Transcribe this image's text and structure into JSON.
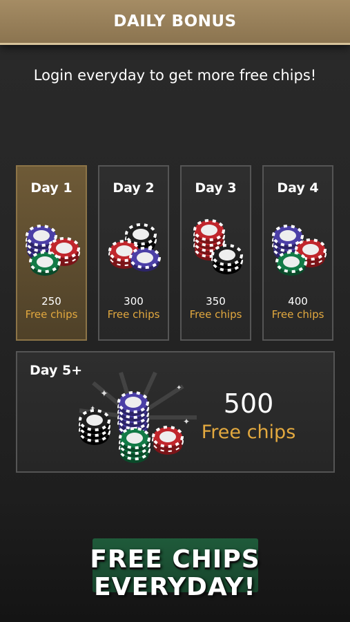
{
  "header": {
    "title": "DAILY BONUS"
  },
  "subtitle": "Login everyday to get more free chips!",
  "days": [
    {
      "label": "Day 1",
      "amount": "250",
      "free_label": "Free chips",
      "active": true
    },
    {
      "label": "Day 2",
      "amount": "300",
      "free_label": "Free chips",
      "active": false
    },
    {
      "label": "Day 3",
      "amount": "350",
      "free_label": "Free chips",
      "active": false
    },
    {
      "label": "Day 4",
      "amount": "400",
      "free_label": "Free chips",
      "active": false
    }
  ],
  "day5": {
    "label": "Day 5+",
    "amount": "500",
    "free_label": "Free chips"
  },
  "promo": {
    "line1": "FREE CHIPS",
    "line2": "EVERYDAY!"
  },
  "colors": {
    "header_gold": "#a58c64",
    "active_card": "#6e5a37",
    "free_text": "#e3a93f",
    "chip_blue": "#4b3fa6",
    "chip_red": "#c0262c",
    "chip_green": "#127a46",
    "chip_black": "#1a1a1a",
    "promo_green": "#1f5a3a"
  }
}
